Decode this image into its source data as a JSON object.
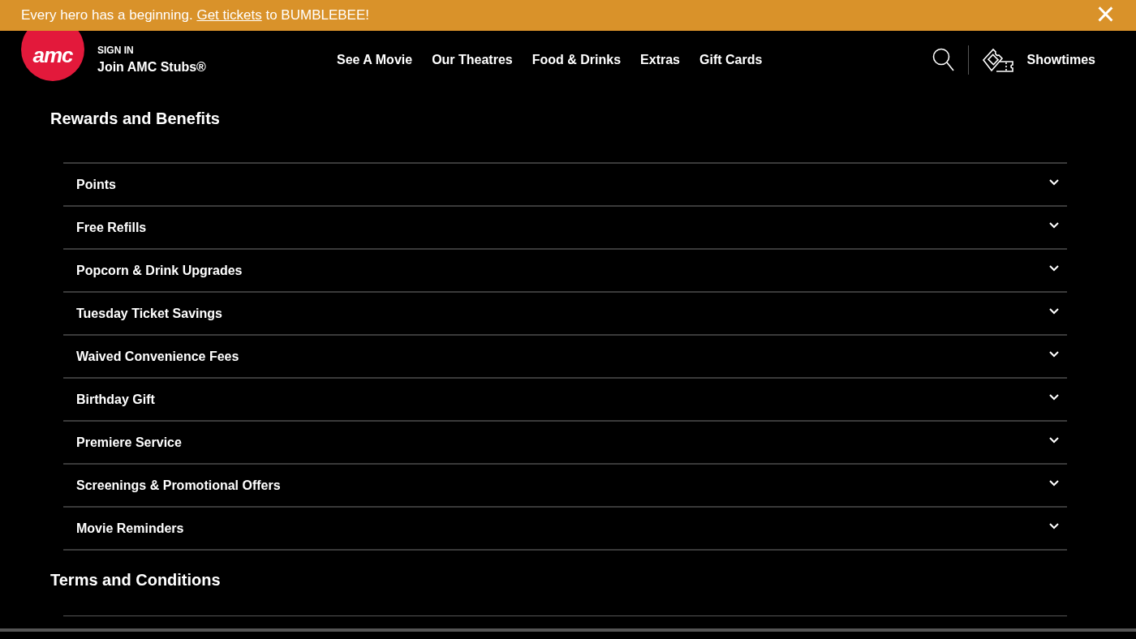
{
  "banner": {
    "text_before": "Every hero has a beginning.",
    "link": "Get tickets",
    "text_after": "to BUMBLEBEE!",
    "close": "×"
  },
  "header": {
    "logo": "amc",
    "sign_in": "SIGN IN",
    "join": "Join AMC Stubs®",
    "nav": [
      "See A Movie",
      "Our Theatres",
      "Food & Drinks",
      "Extras",
      "Gift Cards"
    ],
    "showtimes": "Showtimes"
  },
  "sections": [
    {
      "title": "Rewards and Benefits",
      "items": [
        {
          "label": "Points",
          "expanded": false
        },
        {
          "label": "Free Refills",
          "expanded": false
        },
        {
          "label": "Popcorn & Drink Upgrades",
          "expanded": false
        },
        {
          "label": "Tuesday Ticket Savings",
          "expanded": false
        },
        {
          "label": "Waived Convenience Fees",
          "expanded": false
        },
        {
          "label": "Birthday Gift",
          "expanded": false
        },
        {
          "label": "Premiere Service",
          "expanded": false
        },
        {
          "label": "Screenings & Promotional Offers",
          "expanded": false
        },
        {
          "label": "Movie Reminders",
          "expanded": false
        }
      ]
    },
    {
      "title": "Terms and Conditions"
    }
  ]
}
